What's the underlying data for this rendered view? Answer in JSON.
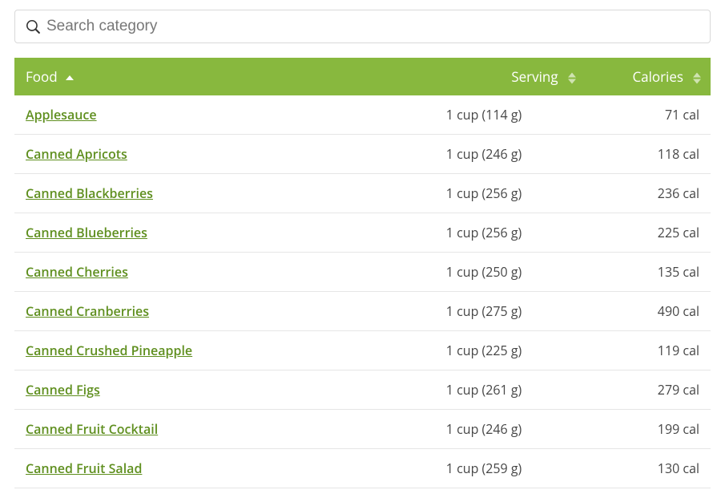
{
  "search": {
    "placeholder": "Search category"
  },
  "columns": {
    "food": "Food",
    "serving": "Serving",
    "calories": "Calories"
  },
  "chart_data": {
    "type": "table",
    "columns": [
      "Food",
      "Serving",
      "Calories"
    ],
    "rows": [
      {
        "food": "Applesauce",
        "serving": "1 cup (114 g)",
        "calories": "71 cal"
      },
      {
        "food": "Canned Apricots",
        "serving": "1 cup (246 g)",
        "calories": "118 cal"
      },
      {
        "food": "Canned Blackberries",
        "serving": "1 cup (256 g)",
        "calories": "236 cal"
      },
      {
        "food": "Canned Blueberries",
        "serving": "1 cup (256 g)",
        "calories": "225 cal"
      },
      {
        "food": "Canned Cherries",
        "serving": "1 cup (250 g)",
        "calories": "135 cal"
      },
      {
        "food": "Canned Cranberries",
        "serving": "1 cup (275 g)",
        "calories": "490 cal"
      },
      {
        "food": "Canned Crushed Pineapple",
        "serving": "1 cup (225 g)",
        "calories": "119 cal"
      },
      {
        "food": "Canned Figs",
        "serving": "1 cup (261 g)",
        "calories": "279 cal"
      },
      {
        "food": "Canned Fruit Cocktail",
        "serving": "1 cup (246 g)",
        "calories": "199 cal"
      },
      {
        "food": "Canned Fruit Salad",
        "serving": "1 cup (259 g)",
        "calories": "130 cal"
      }
    ]
  }
}
